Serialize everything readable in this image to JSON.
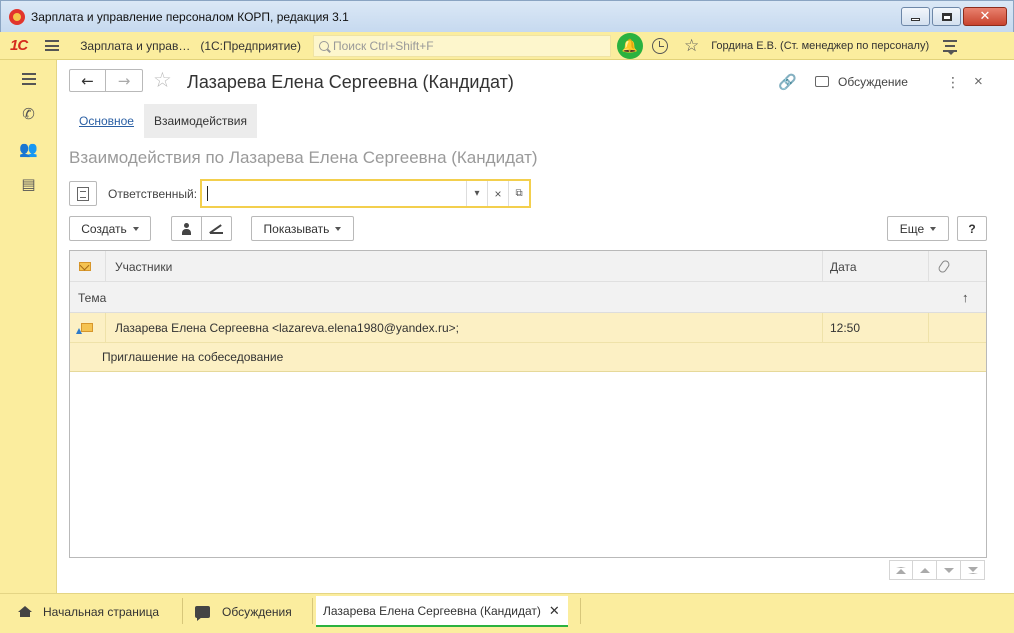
{
  "window": {
    "title": "Зарплата и управление персоналом КОРП, редакция 3.1"
  },
  "topbar": {
    "logo": "1С",
    "app_name": "Зарплата и управ…",
    "platform": "(1С:Предприятие)",
    "search_placeholder": "Поиск Ctrl+Shift+F",
    "user": "Гордина Е.В. (Ст. менеджер по персоналу)",
    "accent": "#fbed9e"
  },
  "form": {
    "title": "Лазарева Елена Сергеевна (Кандидат)",
    "discussion_label": "Обсуждение",
    "tabs": [
      {
        "label": "Основное"
      },
      {
        "label": "Взаимодействия"
      }
    ],
    "list_title": "Взаимодействия по Лазарева Елена Сергеевна (Кандидат)",
    "responsible_label": "Ответственный:",
    "responsible_value": ""
  },
  "commands": {
    "create": "Создать",
    "show": "Показывать",
    "more": "Еще",
    "help": "?"
  },
  "table": {
    "columns": {
      "participants": "Участники",
      "date": "Дата",
      "subject": "Тема",
      "sort_indicator": "↑"
    },
    "rows": [
      {
        "participants": "Лазарева Елена Сергеевна <lazareva.elena1980@yandex.ru>;",
        "date": "12:50",
        "subject": "Приглашение на собеседование",
        "icon": "incoming-email-icon"
      }
    ],
    "row_highlight": "#fcf0c4"
  },
  "bottom_tabs": [
    {
      "label": "Начальная страница",
      "icon": "home-icon"
    },
    {
      "label": "Обсуждения",
      "icon": "chat-icon"
    },
    {
      "label": "Лазарева Елена Сергеевна (Кандидат)",
      "active": true
    }
  ]
}
